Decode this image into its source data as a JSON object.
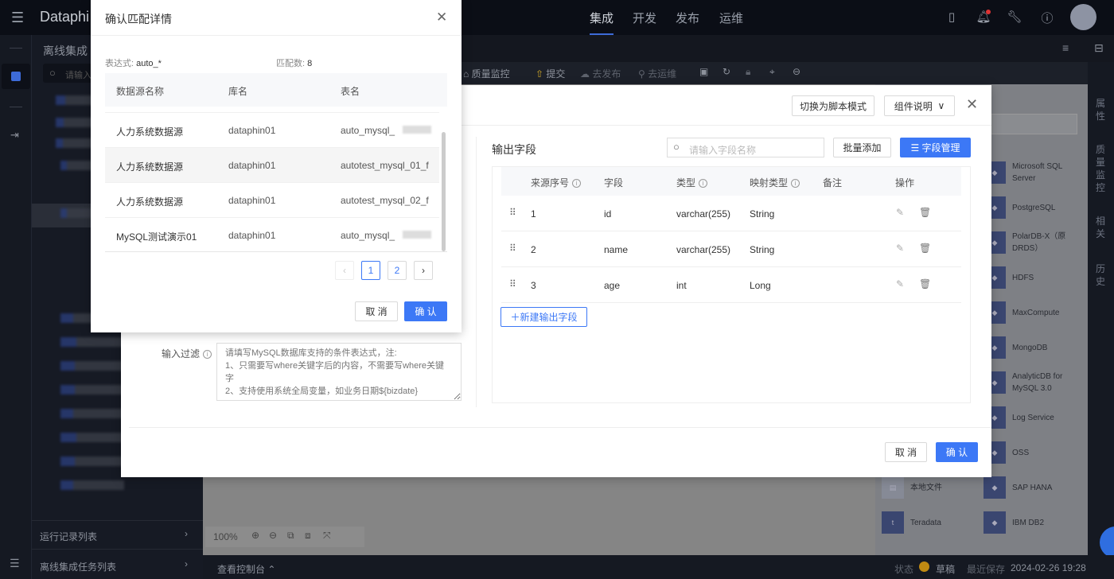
{
  "topbar": {
    "logo": "Dataphi",
    "nav": [
      {
        "label": "集成",
        "active": true
      },
      {
        "label": "开发"
      },
      {
        "label": "发布"
      },
      {
        "label": "运维"
      }
    ],
    "icons": [
      "battery-icon",
      "bell-icon",
      "wrench-icon",
      "help-icon",
      "avatar"
    ]
  },
  "sidebar": {
    "title": "离线集成",
    "search_placeholder": "请输入",
    "bottom": [
      {
        "label": "运行记录列表"
      },
      {
        "label": "离线集成任务列表"
      }
    ]
  },
  "toolbar": {
    "items": [
      "质量监控",
      "提交",
      "去发布",
      "去运维"
    ]
  },
  "canvas": {
    "zoom": "100%"
  },
  "right_panel": {
    "tabs": [
      "属性",
      "质量监控",
      "相关",
      "历史"
    ]
  },
  "components": [
    {
      "name": "Microsoft SQL Server",
      "icon": "sqlserver-icon"
    },
    {
      "name": "PostgreSQL",
      "icon": "postgresql-icon"
    },
    {
      "name": "PolarDB-X（原DRDS）",
      "icon": "polardb-icon"
    },
    {
      "name": "HDFS",
      "icon": "hdfs-icon"
    },
    {
      "name": "MaxCompute",
      "icon": "maxcompute-icon"
    },
    {
      "name": "MongoDB",
      "icon": "mongodb-icon"
    },
    {
      "name": "AnalyticDB for MySQL 3.0",
      "icon": "analyticdb-icon"
    },
    {
      "name": "Log Service",
      "icon": "logservice-icon"
    },
    {
      "name": "OSS",
      "icon": "oss-icon"
    },
    {
      "name": "SAP HANA",
      "icon": "saphana-icon"
    },
    {
      "name": "IBM DB2",
      "icon": "ibm-icon"
    }
  ],
  "components_left": [
    {
      "name": "本地文件",
      "icon": "file-icon"
    },
    {
      "name": "Teradata",
      "icon": "teradata-icon"
    }
  ],
  "status": {
    "console": "查看控制台",
    "state_label": "状态",
    "state": "草稿",
    "saved_label": "最近保存",
    "saved_time": "2024-02-26 19:28"
  },
  "config_modal": {
    "switch_btn": "切换为脚本模式",
    "doc_btn": "组件说明",
    "filter_label": "输入过滤",
    "filter_placeholder": "请填写MySQL数据库支持的条件表达式，注:\n1、只需要写where关键字后的内容，不需要写where关键字\n2、支持使用系统全局变量，如业务日期${bizdate}",
    "output_title": "输出字段",
    "search_placeholder": "请输入字段名称",
    "batch_add": "批量添加",
    "field_manage": "字段管理",
    "columns": [
      "来源序号",
      "字段",
      "类型",
      "映射类型",
      "备注",
      "操作"
    ],
    "rows": [
      {
        "seq": "1",
        "field": "id",
        "type": "varchar(255)",
        "map": "String",
        "note": ""
      },
      {
        "seq": "2",
        "field": "name",
        "type": "varchar(255)",
        "map": "String",
        "note": ""
      },
      {
        "seq": "3",
        "field": "age",
        "type": "int",
        "map": "Long",
        "note": ""
      }
    ],
    "new_field": "新建输出字段",
    "cancel": "取 消",
    "ok": "确 认"
  },
  "match_modal": {
    "title": "确认匹配详情",
    "expr_label": "表达式:",
    "expr": "auto_*",
    "count_label": "匹配数:",
    "count": "8",
    "columns": [
      "数据源名称",
      "库名",
      "表名"
    ],
    "rows": [
      {
        "ds": "人力系统数据源",
        "db": "dataphin01",
        "table": "auto_mysql_"
      },
      {
        "ds": "人力系统数据源",
        "db": "dataphin01",
        "table": "autotest_mysql_01_f"
      },
      {
        "ds": "人力系统数据源",
        "db": "dataphin01",
        "table": "autotest_mysql_02_f"
      },
      {
        "ds": "MySQL测试演示01",
        "db": "dataphin01",
        "table": "auto_mysql_"
      }
    ],
    "pages": [
      "1",
      "2"
    ],
    "current_page": 1,
    "cancel": "取 消",
    "ok": "确 认"
  }
}
